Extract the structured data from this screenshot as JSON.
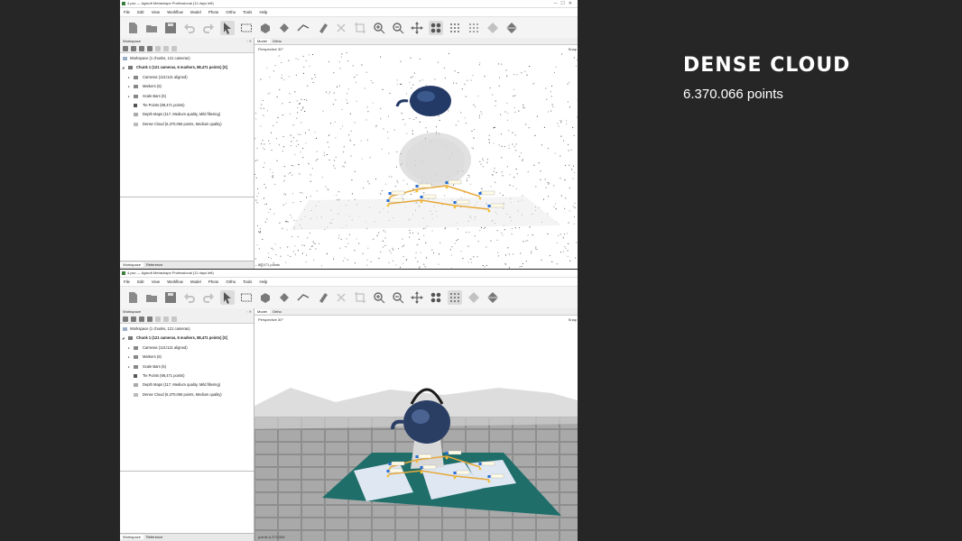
{
  "window_title": "4.psx — Agisoft Metashape Professional (11 days left)",
  "menu": [
    "File",
    "Edit",
    "View",
    "Workflow",
    "Model",
    "Photo",
    "Ortho",
    "Tools",
    "Help"
  ],
  "workspace": {
    "title": "Workspace",
    "root": "Workspace (1 chunks, 121 cameras)",
    "chunk": "Chunk 1 (121 cameras, 6 markers, 88,471 points) [S]",
    "items": [
      "Cameras (121/121 aligned)",
      "Markers (6)",
      "Scale Bars (6)",
      "Tie Points (88,471 points)",
      "Depth Maps (117, Medium quality, Mild filtering)",
      "Dense Cloud (6,370,066 points, Medium quality)"
    ],
    "tabs": [
      "Workspace",
      "Reference"
    ]
  },
  "view": {
    "tabs": [
      "Model",
      "Ortho"
    ],
    "perspective": "Perspective 30°",
    "corner_label": "Snap",
    "point_count": "88,471 points",
    "point_count_dense": "points 6,370,066"
  },
  "slide": {
    "title": "DENSE CLOUD",
    "subtitle": "6.370.066 points"
  },
  "colors": {
    "slide_background": "#262626",
    "mat_teal": "#1f6e6a",
    "marker_blue": "#2a6fd6",
    "highlight_yellow": "#f2c23a"
  },
  "icons": [
    "new-document-icon",
    "open-folder-icon",
    "save-icon",
    "undo-icon",
    "redo-icon",
    "select-arrow-icon",
    "rectangle-selection-icon",
    "resize-region-icon",
    "rotate-region-icon",
    "ruler-icon",
    "erase-icon",
    "crop-icon",
    "zoom-in-icon",
    "zoom-out-icon",
    "move-icon",
    "points-icon",
    "grid-icon",
    "shading-icon",
    "model-icon"
  ]
}
